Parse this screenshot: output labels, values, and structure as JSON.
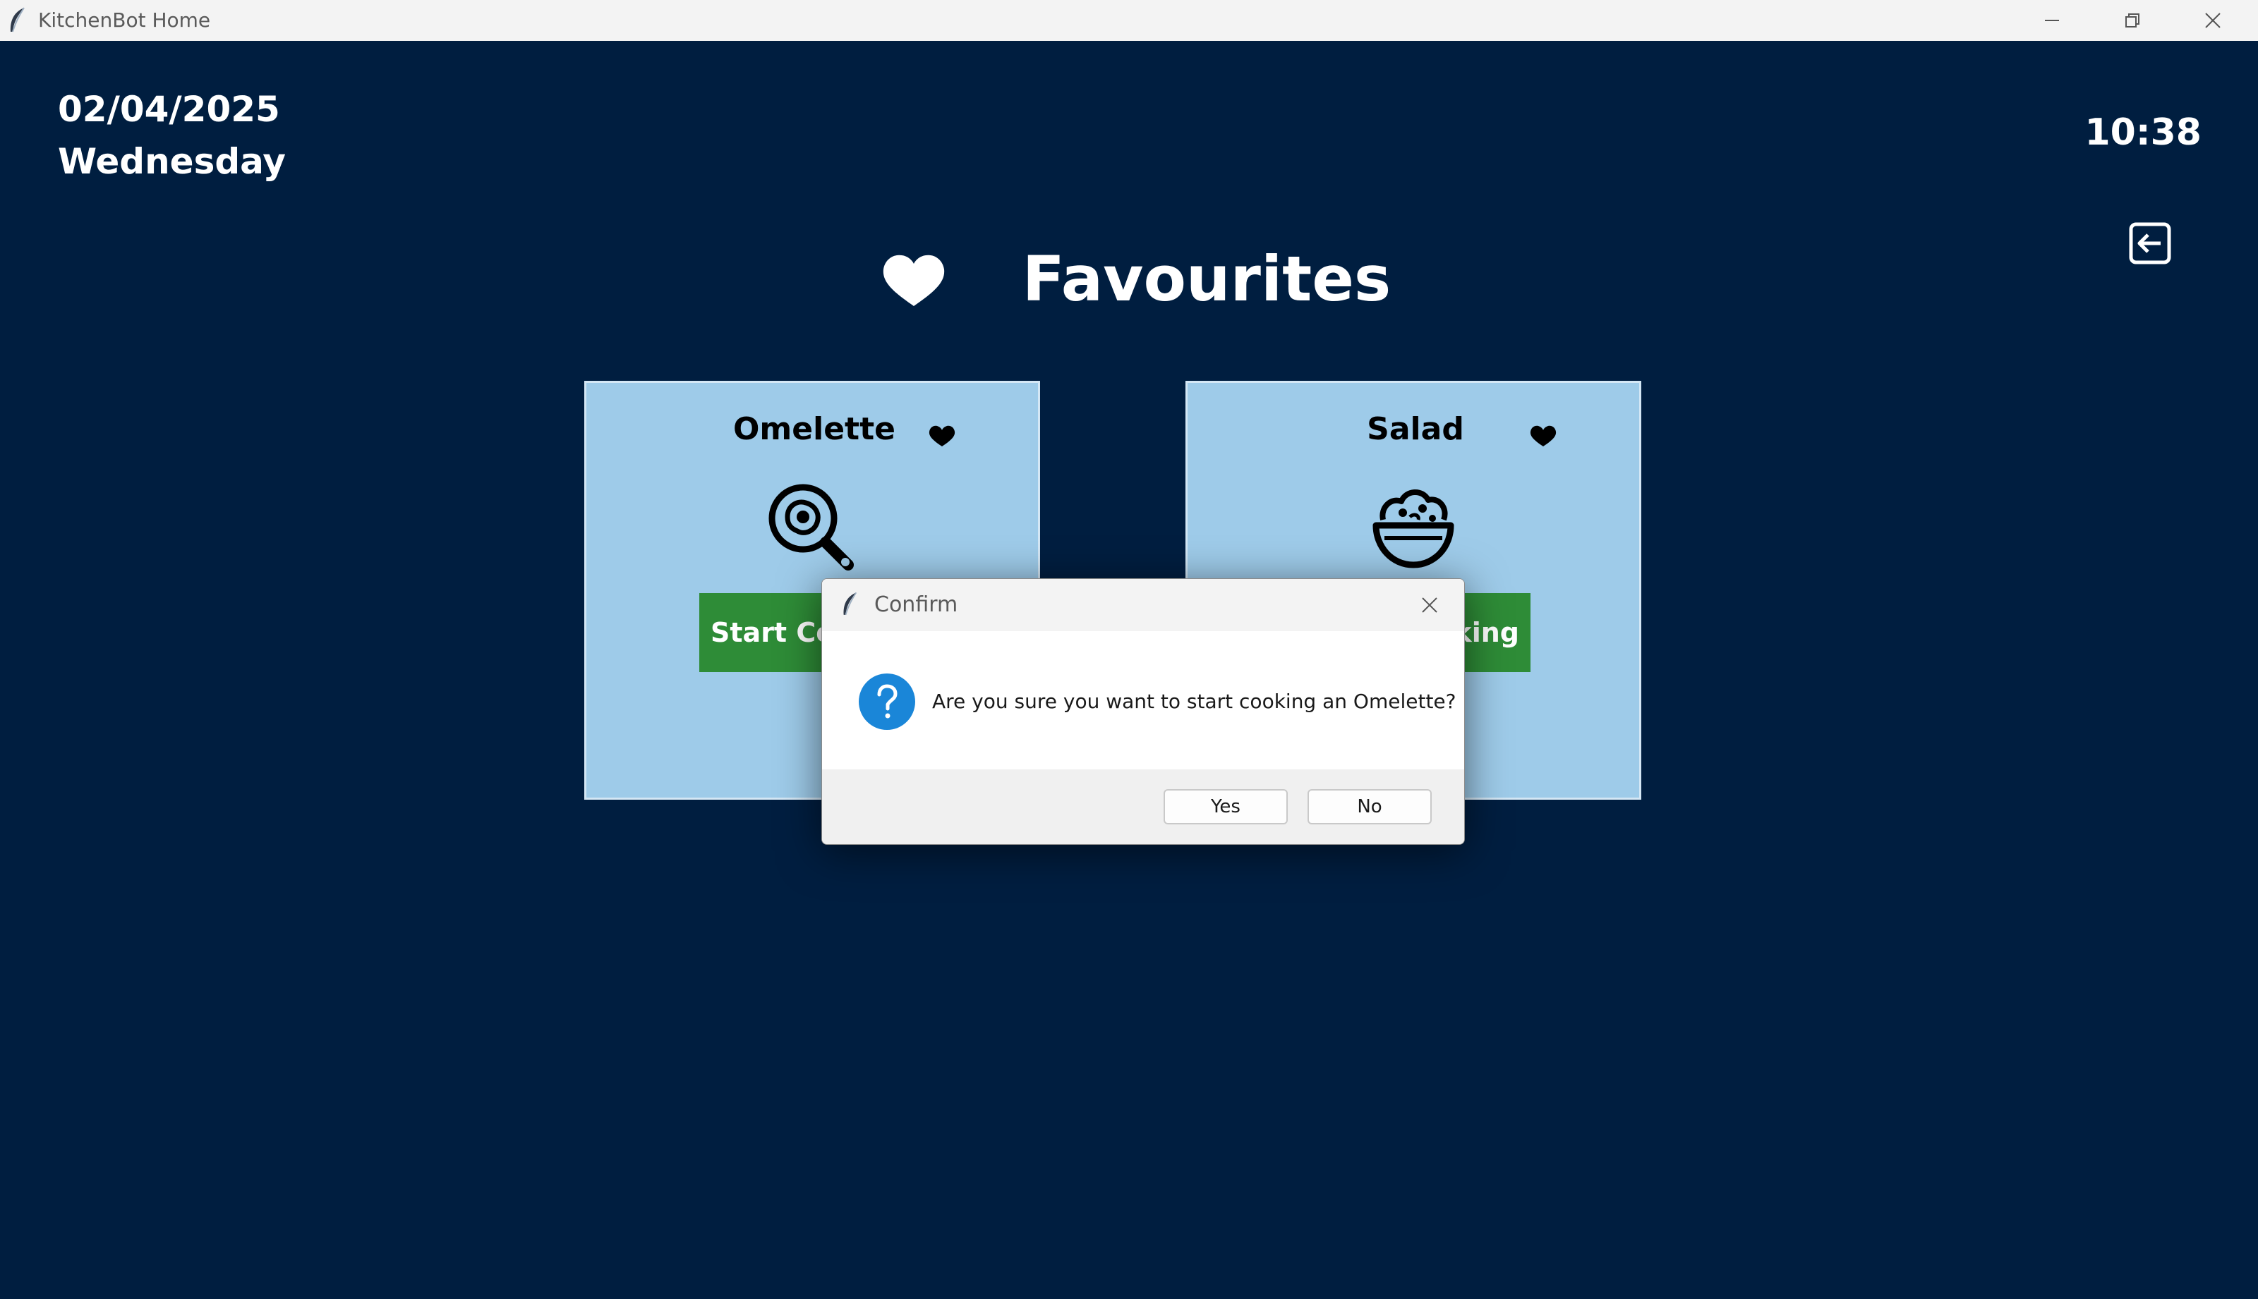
{
  "window": {
    "title": "KitchenBot Home",
    "icons": {
      "app": "feather-icon",
      "minimize": "minimize-icon",
      "maximize": "restore-icon",
      "close": "close-icon"
    }
  },
  "header": {
    "date": "02/04/2025",
    "weekday": "Wednesday",
    "time": "10:38",
    "back_icon": "back-arrow-icon"
  },
  "page": {
    "title": "Favourites",
    "heading_icon": "heart-icon"
  },
  "cards": [
    {
      "name": "Omelette",
      "icon": "frying-pan-egg-icon",
      "favourite_icon": "heart-icon",
      "button_label": "Start Cooking"
    },
    {
      "name": "Salad",
      "icon": "salad-bowl-icon",
      "favourite_icon": "heart-icon",
      "button_label": "Start Cooking"
    }
  ],
  "dialog": {
    "title": "Confirm",
    "message": "Are you sure you want to start cooking an Omelette?",
    "icon": "question-icon",
    "yes_label": "Yes",
    "no_label": "No"
  },
  "colors": {
    "background": "#001e40",
    "card": "#9ecbe9",
    "start_button": "#2e8c37",
    "question_icon": "#1a86d8"
  }
}
